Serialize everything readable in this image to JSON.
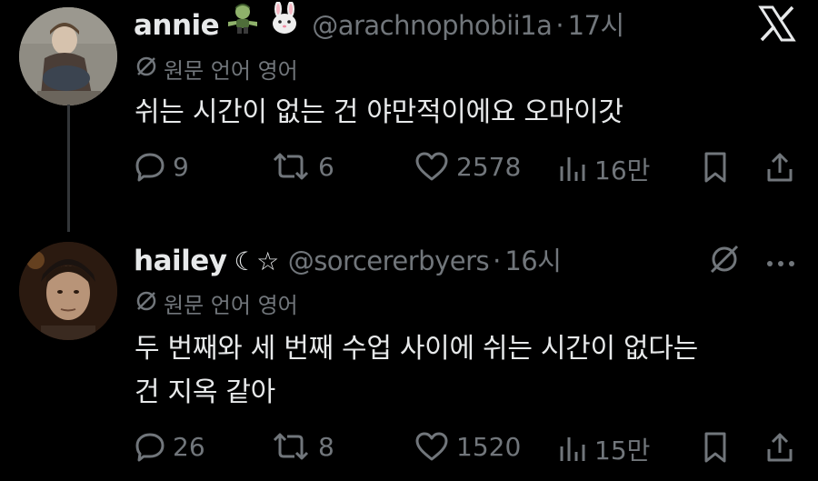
{
  "posts": [
    {
      "display_name": "annie",
      "handle": "@arachnophobii1a",
      "dot": "·",
      "time": "17시",
      "translate_label": "원문 언어 영어",
      "text_lines": [
        "쉬는 시간이 없는 건 야만적이에요 오마이갓"
      ],
      "replies": "9",
      "reposts": "6",
      "likes": "2578",
      "views": "16만"
    },
    {
      "display_name": "hailey",
      "name_suffix": "☾☆",
      "handle": "@sorcererbyers",
      "dot": "·",
      "time": "16시",
      "translate_label": "원문 언어 영어",
      "text_lines": [
        "두 번째와 세 번째 수업 사이에 쉬는 시간이 없다는",
        "건 지옥 같아"
      ],
      "replies": "26",
      "reposts": "8",
      "likes": "1520",
      "views": "15만"
    }
  ],
  "icons": {
    "top_right": "x-logo-icon",
    "reply": "reply-icon",
    "repost": "repost-icon",
    "like": "like-icon",
    "views": "views-icon",
    "bookmark": "bookmark-icon",
    "share": "share-icon",
    "more": "more-icon",
    "grok": "grok-icon",
    "translate": "translate-icon"
  },
  "colors": {
    "background": "#000000",
    "primary_text": "#e7e9ea",
    "secondary_text": "#71767b",
    "thread_line": "#333639"
  }
}
